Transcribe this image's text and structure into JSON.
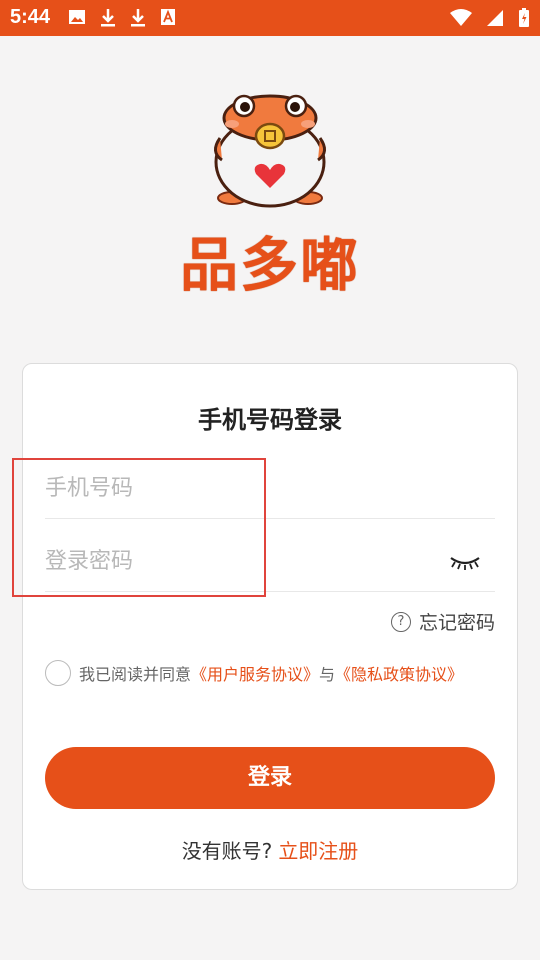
{
  "status_bar": {
    "time": "5:44",
    "left_icons": [
      "image-icon",
      "download-icon",
      "download-icon",
      "font-icon"
    ],
    "right_icons": [
      "wifi-icon",
      "signal-icon",
      "battery-icon"
    ]
  },
  "brand": {
    "name": "品多嘟",
    "color": "#e65019"
  },
  "login_card": {
    "title": "手机号码登录",
    "phone_placeholder": "手机号码",
    "password_placeholder": "登录密码",
    "forgot_password": "忘记密码",
    "help_symbol": "?",
    "agreement_prefix": "我已阅读并同意",
    "user_agreement": "《用户服务协议》",
    "and": "与",
    "privacy_policy": "《隐私政策协议》",
    "login_button": "登录",
    "no_account": "没有账号?",
    "register_link": "立即注册"
  }
}
